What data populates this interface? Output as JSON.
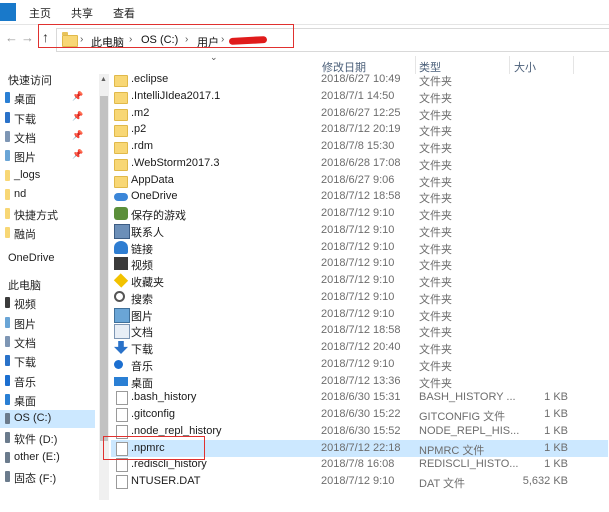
{
  "ribbon": {
    "tabs": [
      "主页",
      "共享",
      "查看"
    ]
  },
  "address": {
    "path": [
      "此电脑",
      "OS (C:)",
      "用户"
    ]
  },
  "columns": [
    "修改日期",
    "类型",
    "大小"
  ],
  "nav": [
    {
      "label": "快速访问",
      "kind": "header"
    },
    {
      "label": "桌面",
      "pin": true,
      "color": "#2a7fd4"
    },
    {
      "label": "下载",
      "pin": true,
      "color": "#2a72c9"
    },
    {
      "label": "文档",
      "pin": true,
      "color": "#7e96b4"
    },
    {
      "label": "图片",
      "pin": true,
      "color": "#6aa5d6"
    },
    {
      "label": "_logs",
      "color": "#f8d775"
    },
    {
      "label": "nd",
      "color": "#f8d775"
    },
    {
      "label": "快捷方式",
      "color": "#f8d775"
    },
    {
      "label": "融尚",
      "color": "#f8d775"
    },
    {
      "label": "",
      "kind": "spacer"
    },
    {
      "label": "OneDrive",
      "kind": "header"
    },
    {
      "label": "",
      "kind": "spacer"
    },
    {
      "label": "此电脑",
      "kind": "header"
    },
    {
      "label": "视频",
      "color": "#3b3b3b"
    },
    {
      "label": "图片",
      "color": "#6aa5d6"
    },
    {
      "label": "文档",
      "color": "#7e96b4"
    },
    {
      "label": "下载",
      "color": "#2a72c9"
    },
    {
      "label": "音乐",
      "color": "#1c6fd0"
    },
    {
      "label": "桌面",
      "color": "#2a7fd4"
    },
    {
      "label": "OS (C:)",
      "selected": true,
      "color": "#6b7b8c"
    },
    {
      "label": "软件 (D:)",
      "color": "#6b7b8c"
    },
    {
      "label": "other (E:)",
      "color": "#6b7b8c"
    },
    {
      "label": "固态 (F:)",
      "color": "#6b7b8c"
    }
  ],
  "files": [
    {
      "name": ".eclipse",
      "date": "2018/6/27 10:49",
      "type": "文件夹",
      "size": "",
      "icon": "folder"
    },
    {
      "name": ".IntelliJIdea2017.1",
      "date": "2018/7/1 14:50",
      "type": "文件夹",
      "size": "",
      "icon": "folder"
    },
    {
      "name": ".m2",
      "date": "2018/6/27 12:25",
      "type": "文件夹",
      "size": "",
      "icon": "folder"
    },
    {
      "name": ".p2",
      "date": "2018/7/12 20:19",
      "type": "文件夹",
      "size": "",
      "icon": "folder"
    },
    {
      "name": ".rdm",
      "date": "2018/7/8 15:30",
      "type": "文件夹",
      "size": "",
      "icon": "folder"
    },
    {
      "name": ".WebStorm2017.3",
      "date": "2018/6/28 17:08",
      "type": "文件夹",
      "size": "",
      "icon": "folder"
    },
    {
      "name": "AppData",
      "date": "2018/6/27 9:06",
      "type": "文件夹",
      "size": "",
      "icon": "folder"
    },
    {
      "name": "OneDrive",
      "date": "2018/7/12 18:58",
      "type": "文件夹",
      "size": "",
      "icon": "cloud"
    },
    {
      "name": "保存的游戏",
      "date": "2018/7/12 9:10",
      "type": "文件夹",
      "size": "",
      "icon": "game"
    },
    {
      "name": "联系人",
      "date": "2018/7/12 9:10",
      "type": "文件夹",
      "size": "",
      "icon": "contacts"
    },
    {
      "name": "链接",
      "date": "2018/7/12 9:10",
      "type": "文件夹",
      "size": "",
      "icon": "link"
    },
    {
      "name": "视频",
      "date": "2018/7/12 9:10",
      "type": "文件夹",
      "size": "",
      "icon": "video"
    },
    {
      "name": "收藏夹",
      "date": "2018/7/12 9:10",
      "type": "文件夹",
      "size": "",
      "icon": "star"
    },
    {
      "name": "搜索",
      "date": "2018/7/12 9:10",
      "type": "文件夹",
      "size": "",
      "icon": "search"
    },
    {
      "name": "图片",
      "date": "2018/7/12 9:10",
      "type": "文件夹",
      "size": "",
      "icon": "pic"
    },
    {
      "name": "文档",
      "date": "2018/7/12 18:58",
      "type": "文件夹",
      "size": "",
      "icon": "docs"
    },
    {
      "name": "下载",
      "date": "2018/7/12 20:40",
      "type": "文件夹",
      "size": "",
      "icon": "down"
    },
    {
      "name": "音乐",
      "date": "2018/7/12 9:10",
      "type": "文件夹",
      "size": "",
      "icon": "music"
    },
    {
      "name": "桌面",
      "date": "2018/7/12 13:36",
      "type": "文件夹",
      "size": "",
      "icon": "desk"
    },
    {
      "name": ".bash_history",
      "date": "2018/6/30 15:31",
      "type": "BASH_HISTORY ...",
      "size": "1 KB",
      "icon": "doc"
    },
    {
      "name": ".gitconfig",
      "date": "2018/6/30 15:22",
      "type": "GITCONFIG 文件",
      "size": "1 KB",
      "icon": "doc"
    },
    {
      "name": ".node_repl_history",
      "date": "2018/6/30 15:52",
      "type": "NODE_REPL_HIS...",
      "size": "1 KB",
      "icon": "doc"
    },
    {
      "name": ".npmrc",
      "date": "2018/7/12 22:18",
      "type": "NPMRC 文件",
      "size": "1 KB",
      "icon": "doc",
      "selected": true
    },
    {
      "name": ".rediscli_history",
      "date": "2018/7/8 16:08",
      "type": "REDISCLI_HISTO...",
      "size": "1 KB",
      "icon": "doc"
    },
    {
      "name": "NTUSER.DAT",
      "date": "2018/7/12 9:10",
      "type": "DAT 文件",
      "size": "5,632 KB",
      "icon": "doc"
    }
  ]
}
